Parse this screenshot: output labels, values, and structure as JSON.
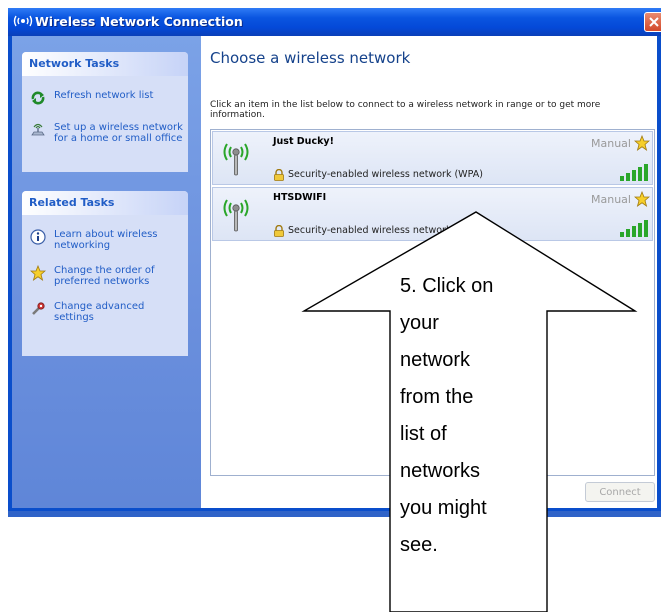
{
  "window": {
    "title": "Wireless Network Connection"
  },
  "left_pane": {
    "network_tasks": {
      "header": "Network Tasks",
      "items": [
        {
          "label_lines": [
            "Refresh network list"
          ],
          "icon": "refresh-icon"
        },
        {
          "label_lines": [
            "Set up a wireless network",
            "for a home or small office"
          ],
          "icon": "wireless-setup-icon"
        }
      ]
    },
    "related_tasks": {
      "header": "Related Tasks",
      "items": [
        {
          "label_lines": [
            "Learn about wireless",
            "networking"
          ],
          "icon": "info-icon"
        },
        {
          "label_lines": [
            "Change the order of",
            "preferred networks"
          ],
          "icon": "star-icon"
        },
        {
          "label_lines": [
            "Change advanced",
            "settings"
          ],
          "icon": "wrench-icon"
        }
      ]
    }
  },
  "main": {
    "heading": "Choose a wireless network",
    "instructions": "Click an item in the list below to connect to a wireless network in range or to get more information.",
    "networks": [
      {
        "name": "Just Ducky!",
        "connection_type": "Manual",
        "security": "Security-enabled wireless network (WPA)",
        "signal_bars": 5,
        "signal_max": 5
      },
      {
        "name": "HTSDWIFI",
        "connection_type": "Manual",
        "security": "Security-enabled wireless network (WPA)",
        "signal_bars": 5,
        "signal_max": 5
      }
    ],
    "connect_label": "Connect"
  },
  "callout": {
    "lines": [
      "5. Click on",
      "your",
      "network",
      "from the",
      "list of",
      "networks",
      "you might",
      "see."
    ]
  },
  "colors": {
    "title_bar": "#0a55e0",
    "left_pane": "#6a8fdd",
    "link_text": "#215dc6",
    "heading_text": "#15428b",
    "signal_green": "#2aa62a",
    "close_button": "#d2482a"
  }
}
